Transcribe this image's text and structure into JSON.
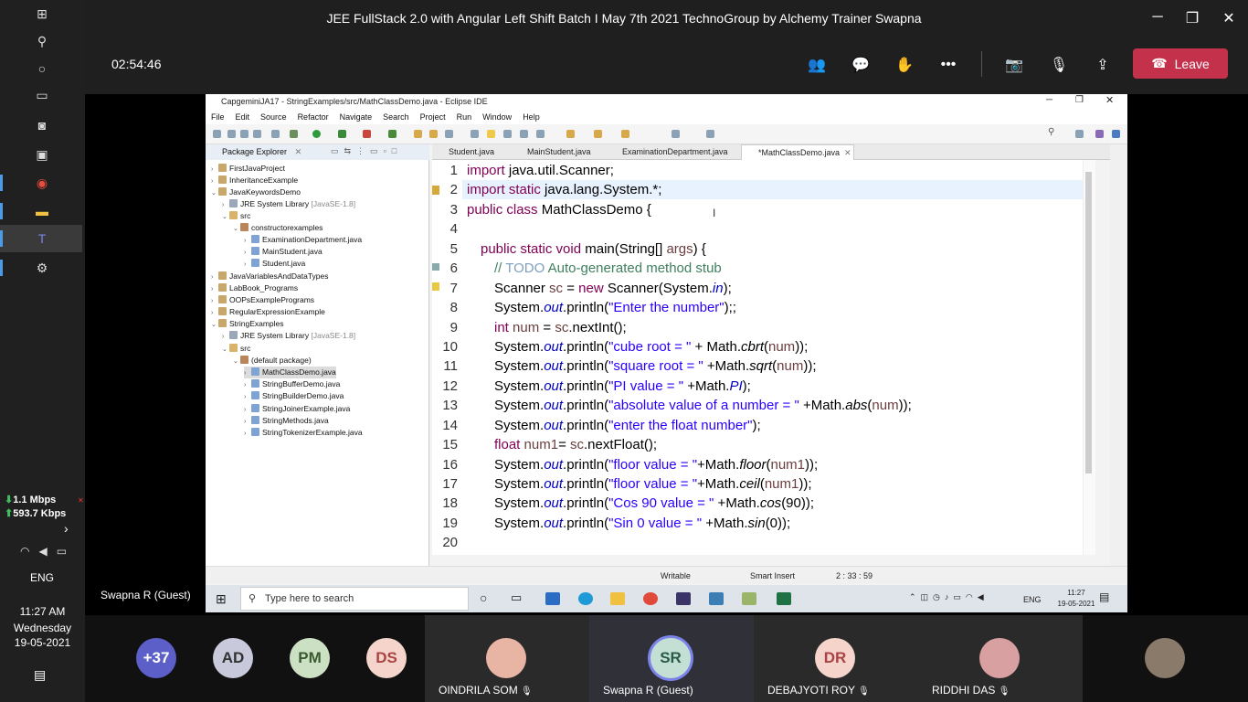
{
  "meeting": {
    "title": "JEE FullStack 2.0 with Angular Left Shift Batch I May 7th 2021 TechnoGroup by Alchemy Trainer Swapna",
    "timer": "02:54:46",
    "leave_label": "Leave",
    "sharer_name": "Swapna R (Guest)"
  },
  "leftbar": {
    "net_down": "1.1 Mbps",
    "net_up": "593.7 Kbps",
    "lang": "ENG",
    "time": "11:27 AM",
    "day": "Wednesday",
    "date": "19-05-2021"
  },
  "participants": {
    "more": "+37",
    "avatars": [
      "AD",
      "PM",
      "DS"
    ],
    "tiles": [
      {
        "initials": "",
        "name": "OINDRILA SOM"
      },
      {
        "initials": "SR",
        "name": "Swapna R (Guest)"
      },
      {
        "initials": "DR",
        "name": "DEBAJYOTI ROY"
      },
      {
        "initials": "",
        "name": "RIDDHI DAS"
      }
    ]
  },
  "eclipse": {
    "title": "CapgeminiJA17 - StringExamples/src/MathClassDemo.java - Eclipse IDE",
    "menu": [
      "File",
      "Edit",
      "Source",
      "Refactor",
      "Navigate",
      "Search",
      "Project",
      "Run",
      "Window",
      "Help"
    ],
    "package_explorer_title": "Package Explorer",
    "tree": [
      "FirstJavaProject",
      "InheritanceExample",
      "JavaKeywordsDemo",
      "JRE System Library",
      "[JavaSE-1.8]",
      "src",
      "constructorexamples",
      "ExaminationDepartment.java",
      "MainStudent.java",
      "Student.java",
      "JavaVariablesAndDataTypes",
      "LabBook_Programs",
      "OOPsExamplePrograms",
      "RegularExpressionExample",
      "StringExamples",
      "JRE System Library",
      "[JavaSE-1.8]",
      "src",
      "(default package)",
      "MathClassDemo.java",
      "StringBufferDemo.java",
      "StringBuilderDemo.java",
      "StringJoinerExample.java",
      "StringMethods.java",
      "StringTokenizerExample.java"
    ],
    "tabs": [
      "Student.java",
      "MainStudent.java",
      "ExaminationDepartment.java",
      "*MathClassDemo.java"
    ],
    "status": {
      "mode": "Writable",
      "insert": "Smart Insert",
      "pos": "2 : 33 : 59"
    }
  },
  "code": {
    "lines": [
      "1",
      "2",
      "3",
      "4",
      "5",
      "6",
      "7",
      "8",
      "9",
      "10",
      "11",
      "12",
      "13",
      "14",
      "15",
      "16",
      "17",
      "18",
      "19",
      "20"
    ],
    "l1_kw": "import",
    "l1_rest": " java.util.Scanner;",
    "l2_kw": "import static",
    "l2_rest": " java.lang.System.*;",
    "l3_kw": "public class",
    "l3_rest": " MathClassDemo {",
    "l5_kw": "public static void",
    "l5_a": " main(String[] ",
    "l5_var": "args",
    "l5_b": ") {",
    "l6_a": "// ",
    "l6_todo": "TODO",
    "l6_b": " Auto-generated method stub",
    "l7_a": "Scanner ",
    "l7_var": "sc",
    "l7_b": " = ",
    "l7_kw": "new",
    "l7_c": " Scanner(System.",
    "l7_fld": "in",
    "l7_d": ");",
    "l8_a": "System.",
    "l8_fld": "out",
    "l8_b": ".println(",
    "l8_str": "\"Enter the number\"",
    "l8_c": ");;",
    "l9_kw": "int",
    "l9_a": " ",
    "l9_var": "num",
    "l9_b": " = ",
    "l9_var2": "sc",
    "l9_c": ".nextInt();",
    "l10_a": "System.",
    "l10_fld": "out",
    "l10_b": ".println(",
    "l10_str": "\"cube root = \"",
    "l10_c": " + Math.",
    "l10_it": "cbrt",
    "l10_d": "(",
    "l10_var": "num",
    "l10_e": "));",
    "l11_a": "System.",
    "l11_fld": "out",
    "l11_b": ".println(",
    "l11_str": "\"square root = \"",
    "l11_c": " +Math.",
    "l11_it": "sqrt",
    "l11_d": "(",
    "l11_var": "num",
    "l11_e": "));",
    "l12_a": "System.",
    "l12_fld": "out",
    "l12_b": ".println(",
    "l12_str": "\"PI value = \"",
    "l12_c": " +Math.",
    "l12_it": "PI",
    "l12_d": ");",
    "l13_a": "System.",
    "l13_fld": "out",
    "l13_b": ".println(",
    "l13_str": "\"absolute value of a number = \"",
    "l13_c": " +Math.",
    "l13_it": "abs",
    "l13_d": "(",
    "l13_var": "num",
    "l13_e": "));",
    "l14_a": "System.",
    "l14_fld": "out",
    "l14_b": ".println(",
    "l14_str": "\"enter the float number\"",
    "l14_c": ");",
    "l15_kw": "float",
    "l15_a": " ",
    "l15_var": "num1",
    "l15_b": "= ",
    "l15_var2": "sc",
    "l15_c": ".nextFloat();",
    "l16_a": "System.",
    "l16_fld": "out",
    "l16_b": ".println(",
    "l16_str": "\"floor value = \"",
    "l16_c": "+Math.",
    "l16_it": "floor",
    "l16_d": "(",
    "l16_var": "num1",
    "l16_e": "));",
    "l17_a": "System.",
    "l17_fld": "out",
    "l17_b": ".println(",
    "l17_str": "\"floor value = \"",
    "l17_c": "+Math.",
    "l17_it": "ceil",
    "l17_d": "(",
    "l17_var": "num1",
    "l17_e": "));",
    "l18_a": "System.",
    "l18_fld": "out",
    "l18_b": ".println(",
    "l18_str": "\"Cos 90 value = \"",
    "l18_c": " +Math.",
    "l18_it": "cos",
    "l18_d": "(90));",
    "l19_a": "System.",
    "l19_fld": "out",
    "l19_b": ".println(",
    "l19_str": "\"Sin 0 value = \"",
    "l19_c": " +Math.",
    "l19_it": "sin",
    "l19_d": "(0));"
  },
  "win_taskbar": {
    "search_placeholder": "Type here to search",
    "lang": "ENG",
    "time": "11:27",
    "date": "19-05-2021"
  }
}
